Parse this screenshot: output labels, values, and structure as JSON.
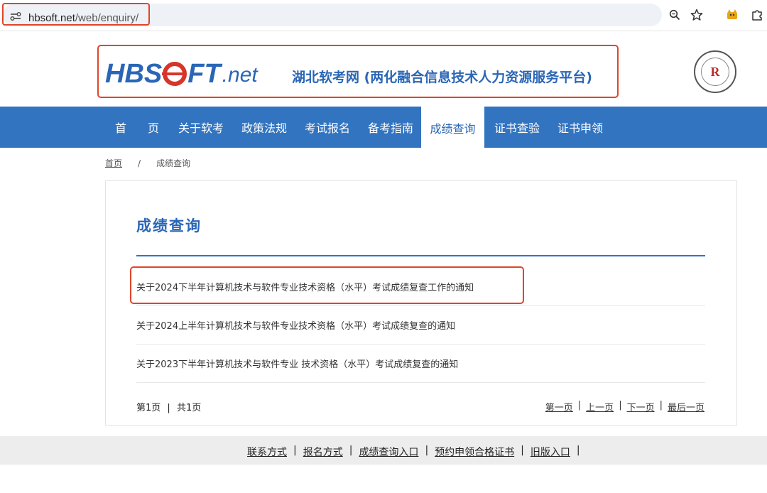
{
  "browser": {
    "url_host": "hbsoft.net",
    "url_path": "/web/enquiry/",
    "icons": [
      "site-info-icon",
      "zoom-icon",
      "bookmark-star-icon",
      "extension-fox-icon",
      "extensions-puzzle-icon"
    ],
    "highlight_color": "#e0452a"
  },
  "header": {
    "logo_main_left": "HBS",
    "logo_main_right": "FT",
    "logo_suffix": ".net",
    "site_title": "湖北软考网 (两化融合信息技术人力资源服务平台)",
    "emblem_letter": "R",
    "brand_color": "#2a66b5",
    "logo_accent_color": "#d8352a"
  },
  "nav": {
    "items": [
      {
        "label": "首"
      },
      {
        "label": "页"
      },
      {
        "label": "关于软考"
      },
      {
        "label": "政策法规"
      },
      {
        "label": "考试报名"
      },
      {
        "label": "备考指南"
      },
      {
        "label": "成绩查询",
        "active": true
      },
      {
        "label": "证书查验"
      },
      {
        "label": "证书申领"
      }
    ],
    "bg_color": "#3274c0"
  },
  "breadcrumb": {
    "home": "首页",
    "separator": "/",
    "current": "成绩查询"
  },
  "main": {
    "title": "成绩查询",
    "notices": [
      "关于2024下半年计算机技术与软件专业技术资格（水平）考试成绩复查工作的通知",
      "关于2024上半年计算机技术与软件专业技术资格（水平）考试成绩复查的通知",
      "关于2023下半年计算机技术与软件专业 技术资格（水平）考试成绩复查的通知"
    ],
    "pager": {
      "current": "第1页",
      "separator": "|",
      "total": "共1页",
      "first": "第一页",
      "prev": "上一页",
      "next": "下一页",
      "last": "最后一页"
    }
  },
  "footer": {
    "links": [
      "联系方式",
      "报名方式",
      "成绩查询入口",
      "预约申领合格证书",
      "旧版入口"
    ],
    "separator": "|"
  }
}
